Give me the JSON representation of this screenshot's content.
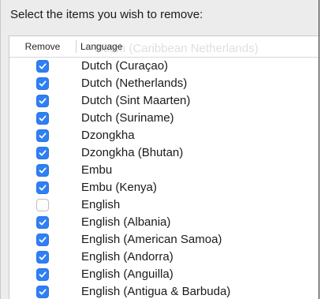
{
  "prompt": "Select the items you wish to remove:",
  "table": {
    "columns": {
      "remove": "Remove",
      "language": "Language"
    },
    "ghost_text": "Dutch (Caribbean Netherlands)",
    "rows": [
      {
        "checked": true,
        "label": "Dutch (Curaçao)"
      },
      {
        "checked": true,
        "label": "Dutch (Netherlands)"
      },
      {
        "checked": true,
        "label": "Dutch (Sint Maarten)"
      },
      {
        "checked": true,
        "label": "Dutch (Suriname)"
      },
      {
        "checked": true,
        "label": "Dzongkha"
      },
      {
        "checked": true,
        "label": "Dzongkha (Bhutan)"
      },
      {
        "checked": true,
        "label": "Embu"
      },
      {
        "checked": true,
        "label": "Embu (Kenya)"
      },
      {
        "checked": false,
        "label": "English"
      },
      {
        "checked": true,
        "label": "English (Albania)"
      },
      {
        "checked": true,
        "label": "English (American Samoa)"
      },
      {
        "checked": true,
        "label": "English (Andorra)"
      },
      {
        "checked": true,
        "label": "English (Anguilla)"
      },
      {
        "checked": true,
        "label": "English (Antigua & Barbuda)"
      }
    ]
  },
  "colors": {
    "accent": "#2f7ff5"
  }
}
